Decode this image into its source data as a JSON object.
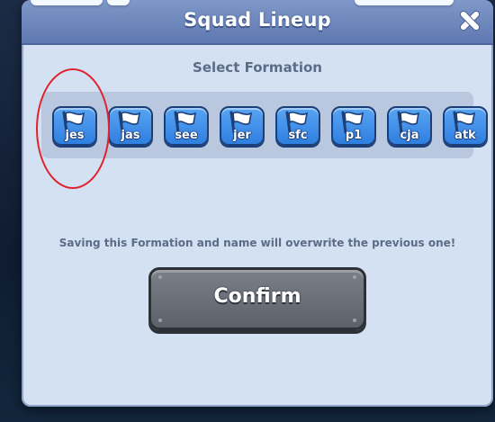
{
  "dialog": {
    "title": "Squad Lineup",
    "close_icon": "close-icon",
    "subtitle": "Select Formation",
    "formations": [
      {
        "label": "jes",
        "icon": "flag-icon",
        "highlighted": true
      },
      {
        "label": "jas",
        "icon": "flag-icon"
      },
      {
        "label": "see",
        "icon": "flag-icon"
      },
      {
        "label": "jer",
        "icon": "flag-icon"
      },
      {
        "label": "sfc",
        "icon": "flag-icon"
      },
      {
        "label": "p1",
        "icon": "flag-icon"
      },
      {
        "label": "cja",
        "icon": "flag-icon"
      },
      {
        "label": "atk",
        "icon": "flag-icon"
      }
    ],
    "warning": "Saving this Formation and name will overwrite the previous one!",
    "confirm_label": "Confirm"
  },
  "colors": {
    "header": "#6f89bf",
    "panel": "#d4e1f3",
    "formation_button": "#3d8ce8",
    "confirm_button": "#6b6f78",
    "highlight": "#e0222c"
  }
}
